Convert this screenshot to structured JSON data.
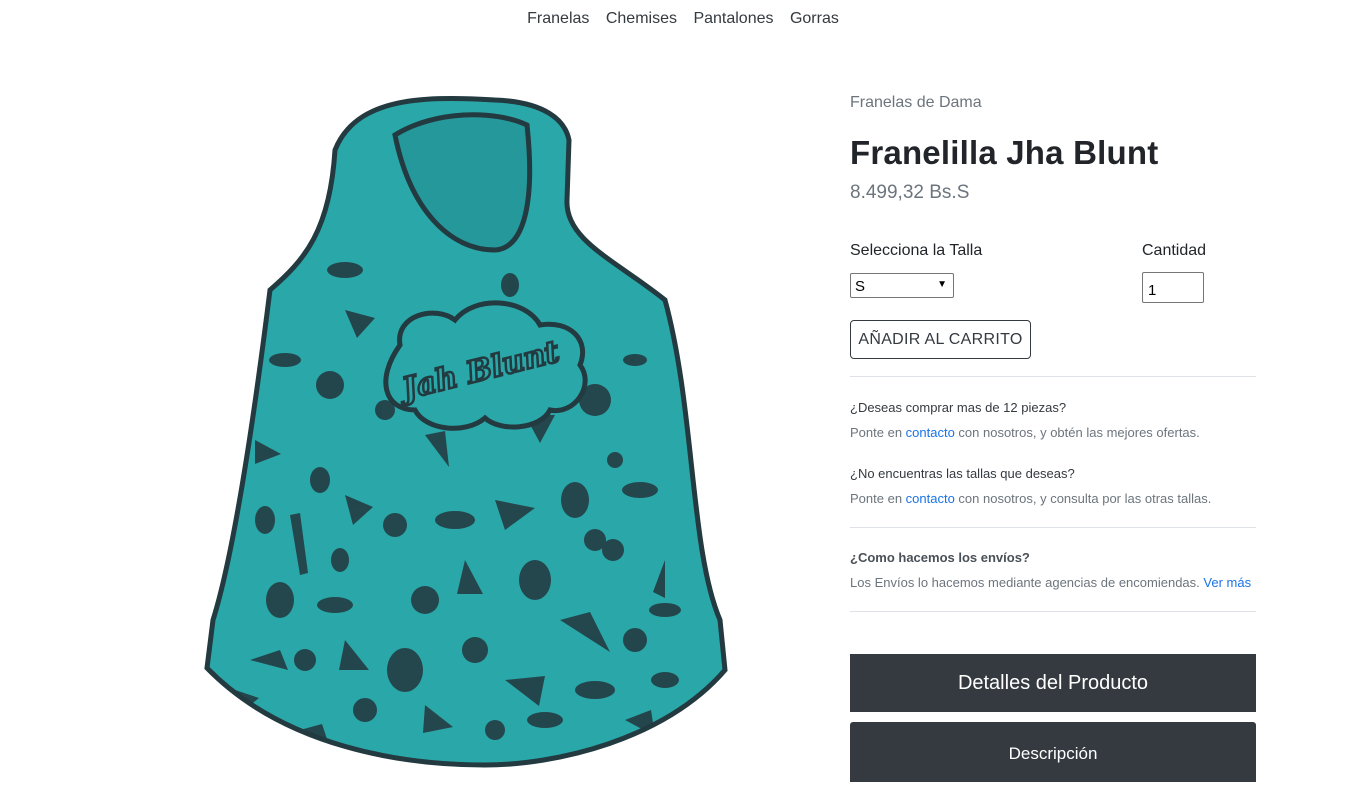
{
  "nav": {
    "items": [
      {
        "label": "Franelas"
      },
      {
        "label": "Chemises"
      },
      {
        "label": "Pantalones"
      },
      {
        "label": "Gorras"
      }
    ]
  },
  "product": {
    "image_text": "Jah Blunt",
    "category": "Franelas de Dama",
    "title": "Franelilla Jha Blunt",
    "price": "8.499,32 Bs.S"
  },
  "form": {
    "size_label": "Selecciona la Talla",
    "size_selected": "S",
    "quantity_label": "Cantidad",
    "quantity_value": "1",
    "add_to_cart": "AÑADIR AL CARRITO"
  },
  "info": {
    "bulk_question": "¿Deseas comprar mas de 12 piezas?",
    "bulk_pre": "Ponte en ",
    "bulk_link": "contacto",
    "bulk_post": " con nosotros, y obtén las mejores ofertas.",
    "sizes_question": "¿No encuentras las tallas que deseas?",
    "sizes_pre": "Ponte en ",
    "sizes_link": "contacto",
    "sizes_post": " con nosotros, y consulta por las otras tallas.",
    "shipping_question": "¿Como hacemos los envíos?",
    "shipping_text": "Los Envíos lo hacemos mediante agencias de encomiendas. ",
    "shipping_link": "Ver más"
  },
  "panels": {
    "details": "Detalles del Producto",
    "description": "Descripción"
  },
  "colors": {
    "shirt": "#2aa7a8",
    "print": "#233a40",
    "accent": "#343a40",
    "link": "#1a73e8"
  }
}
